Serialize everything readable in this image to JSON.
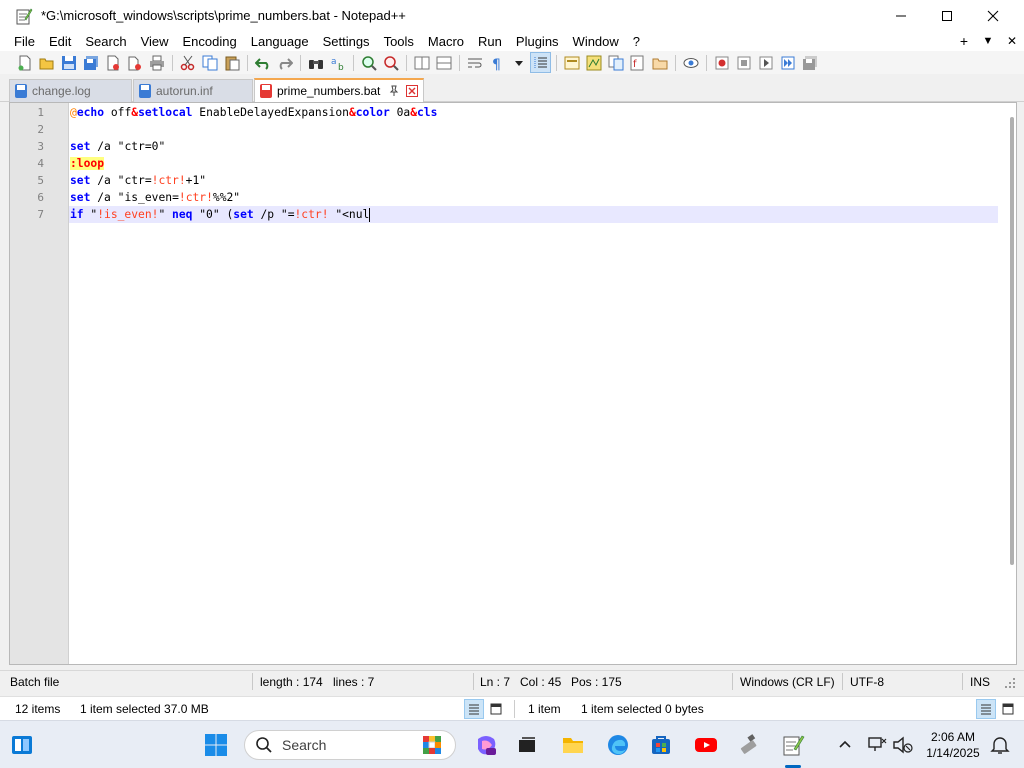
{
  "window": {
    "title": "*G:\\microsoft_windows\\scripts\\prime_numbers.bat - Notepad++"
  },
  "menu": {
    "items": [
      "File",
      "Edit",
      "Search",
      "View",
      "Encoding",
      "Language",
      "Settings",
      "Tools",
      "Macro",
      "Run",
      "Plugins",
      "Window",
      "?"
    ],
    "right": [
      "+",
      "▼",
      "✕"
    ]
  },
  "tabs": [
    {
      "label": "change.log",
      "active": false
    },
    {
      "label": "autorun.inf",
      "active": false
    },
    {
      "label": "prime_numbers.bat",
      "active": true
    }
  ],
  "editor": {
    "line_numbers": [
      "1",
      "2",
      "3",
      "4",
      "5",
      "6",
      "7"
    ],
    "current_line": 7,
    "lines": [
      "@echo off&setlocal EnableDelayedExpansion&color 0a&cls",
      "",
      "set /a \"ctr=0\"",
      ":loop",
      "set /a \"ctr=!ctr!+1\"",
      "set /a \"is_even=!ctr!%%2\"",
      "if \"!is_even!\" neq \"0\" (set /p \"=!ctr! \"<nul"
    ]
  },
  "statusbar": {
    "language": "Batch file",
    "length": "length : 174",
    "lines": "lines : 7",
    "ln": "Ln : 7",
    "col": "Col : 45",
    "pos": "Pos : 175",
    "eol": "Windows (CR LF)",
    "encoding": "UTF-8",
    "mode": "INS"
  },
  "explorer": {
    "left_items": "12 items",
    "left_selected": "1 item selected  37.0 MB",
    "right_items": "1 item",
    "right_selected": "1 item selected  0 bytes"
  },
  "taskbar": {
    "search_placeholder": "Search",
    "time": "2:06 AM",
    "date": "1/14/2025",
    "accent": "#0067c0"
  },
  "colors": {
    "keyword": "#0000ff",
    "variable": "#ff4020",
    "label_bg": "#ffff80",
    "active_tab_accent": "#f4a74e",
    "current_line_bg": "#e8e8ff"
  }
}
